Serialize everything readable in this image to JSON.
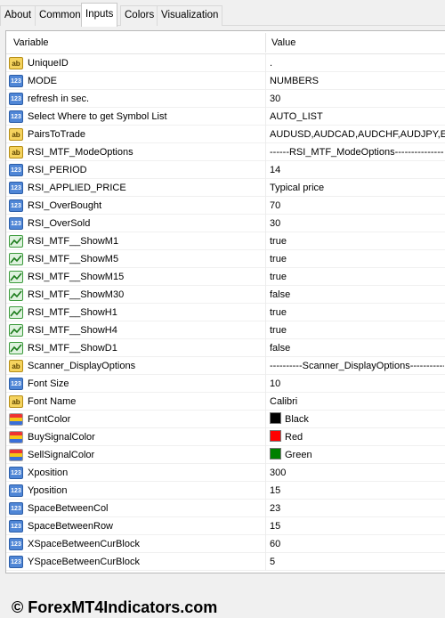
{
  "tabs": [
    {
      "label": "About"
    },
    {
      "label": "Common"
    },
    {
      "label": "Inputs",
      "active": true
    },
    {
      "label": "Colors"
    },
    {
      "label": "Visualization"
    }
  ],
  "table": {
    "header_variable": "Variable",
    "header_value": "Value"
  },
  "rows": [
    {
      "icon": "string-icon",
      "name": "UniqueID",
      "value": "."
    },
    {
      "icon": "enum-icon",
      "name": "MODE",
      "value": "NUMBERS"
    },
    {
      "icon": "integer-icon",
      "name": "refresh in sec.",
      "value": "30"
    },
    {
      "icon": "enum-icon",
      "name": "Select Where to get Symbol List",
      "value": "AUTO_LIST"
    },
    {
      "icon": "string-icon",
      "name": "PairsToTrade",
      "value": "AUDUSD,AUDCAD,AUDCHF,AUDJPY,EURUSD"
    },
    {
      "icon": "string-icon",
      "name": "RSI_MTF_ModeOptions",
      "value": "------RSI_MTF_ModeOptions--------------------"
    },
    {
      "icon": "integer-icon",
      "name": "RSI_PERIOD",
      "value": "14"
    },
    {
      "icon": "enum-icon",
      "name": "RSI_APPLIED_PRICE",
      "value": "Typical price"
    },
    {
      "icon": "integer-icon",
      "name": "RSI_OverBought",
      "value": "70"
    },
    {
      "icon": "integer-icon",
      "name": "RSI_OverSold",
      "value": "30"
    },
    {
      "icon": "bool-icon",
      "name": "RSI_MTF__ShowM1",
      "value": "true"
    },
    {
      "icon": "bool-icon",
      "name": "RSI_MTF__ShowM5",
      "value": "true"
    },
    {
      "icon": "bool-icon",
      "name": "RSI_MTF__ShowM15",
      "value": "true"
    },
    {
      "icon": "bool-icon",
      "name": "RSI_MTF__ShowM30",
      "value": "false"
    },
    {
      "icon": "bool-icon",
      "name": "RSI_MTF__ShowH1",
      "value": "true"
    },
    {
      "icon": "bool-icon",
      "name": "RSI_MTF__ShowH4",
      "value": "true"
    },
    {
      "icon": "bool-icon",
      "name": "RSI_MTF__ShowD1",
      "value": "false"
    },
    {
      "icon": "string-icon",
      "name": "Scanner_DisplayOptions",
      "value": "----------Scanner_DisplayOptions-------------"
    },
    {
      "icon": "integer-icon",
      "name": "Font Size",
      "value": "10"
    },
    {
      "icon": "string-icon",
      "name": "Font Name",
      "value": "Calibri"
    },
    {
      "icon": "color-icon",
      "name": "FontColor",
      "value": "Black",
      "swatch": "#000000"
    },
    {
      "icon": "color-icon",
      "name": "BuySignalColor",
      "value": "Red",
      "swatch": "#ff0000"
    },
    {
      "icon": "color-icon",
      "name": "SellSignalColor",
      "value": "Green",
      "swatch": "#008000"
    },
    {
      "icon": "integer-icon",
      "name": "Xposition",
      "value": "300"
    },
    {
      "icon": "integer-icon",
      "name": "Yposition",
      "value": "15"
    },
    {
      "icon": "integer-icon",
      "name": "SpaceBetweenCol",
      "value": "23"
    },
    {
      "icon": "integer-icon",
      "name": "SpaceBetweenRow",
      "value": "15"
    },
    {
      "icon": "integer-icon",
      "name": "XSpaceBetweenCurBlock",
      "value": "60"
    },
    {
      "icon": "integer-icon",
      "name": "YSpaceBetweenCurBlock",
      "value": "5"
    }
  ],
  "watermark": "© ForexMT4Indicators.com"
}
